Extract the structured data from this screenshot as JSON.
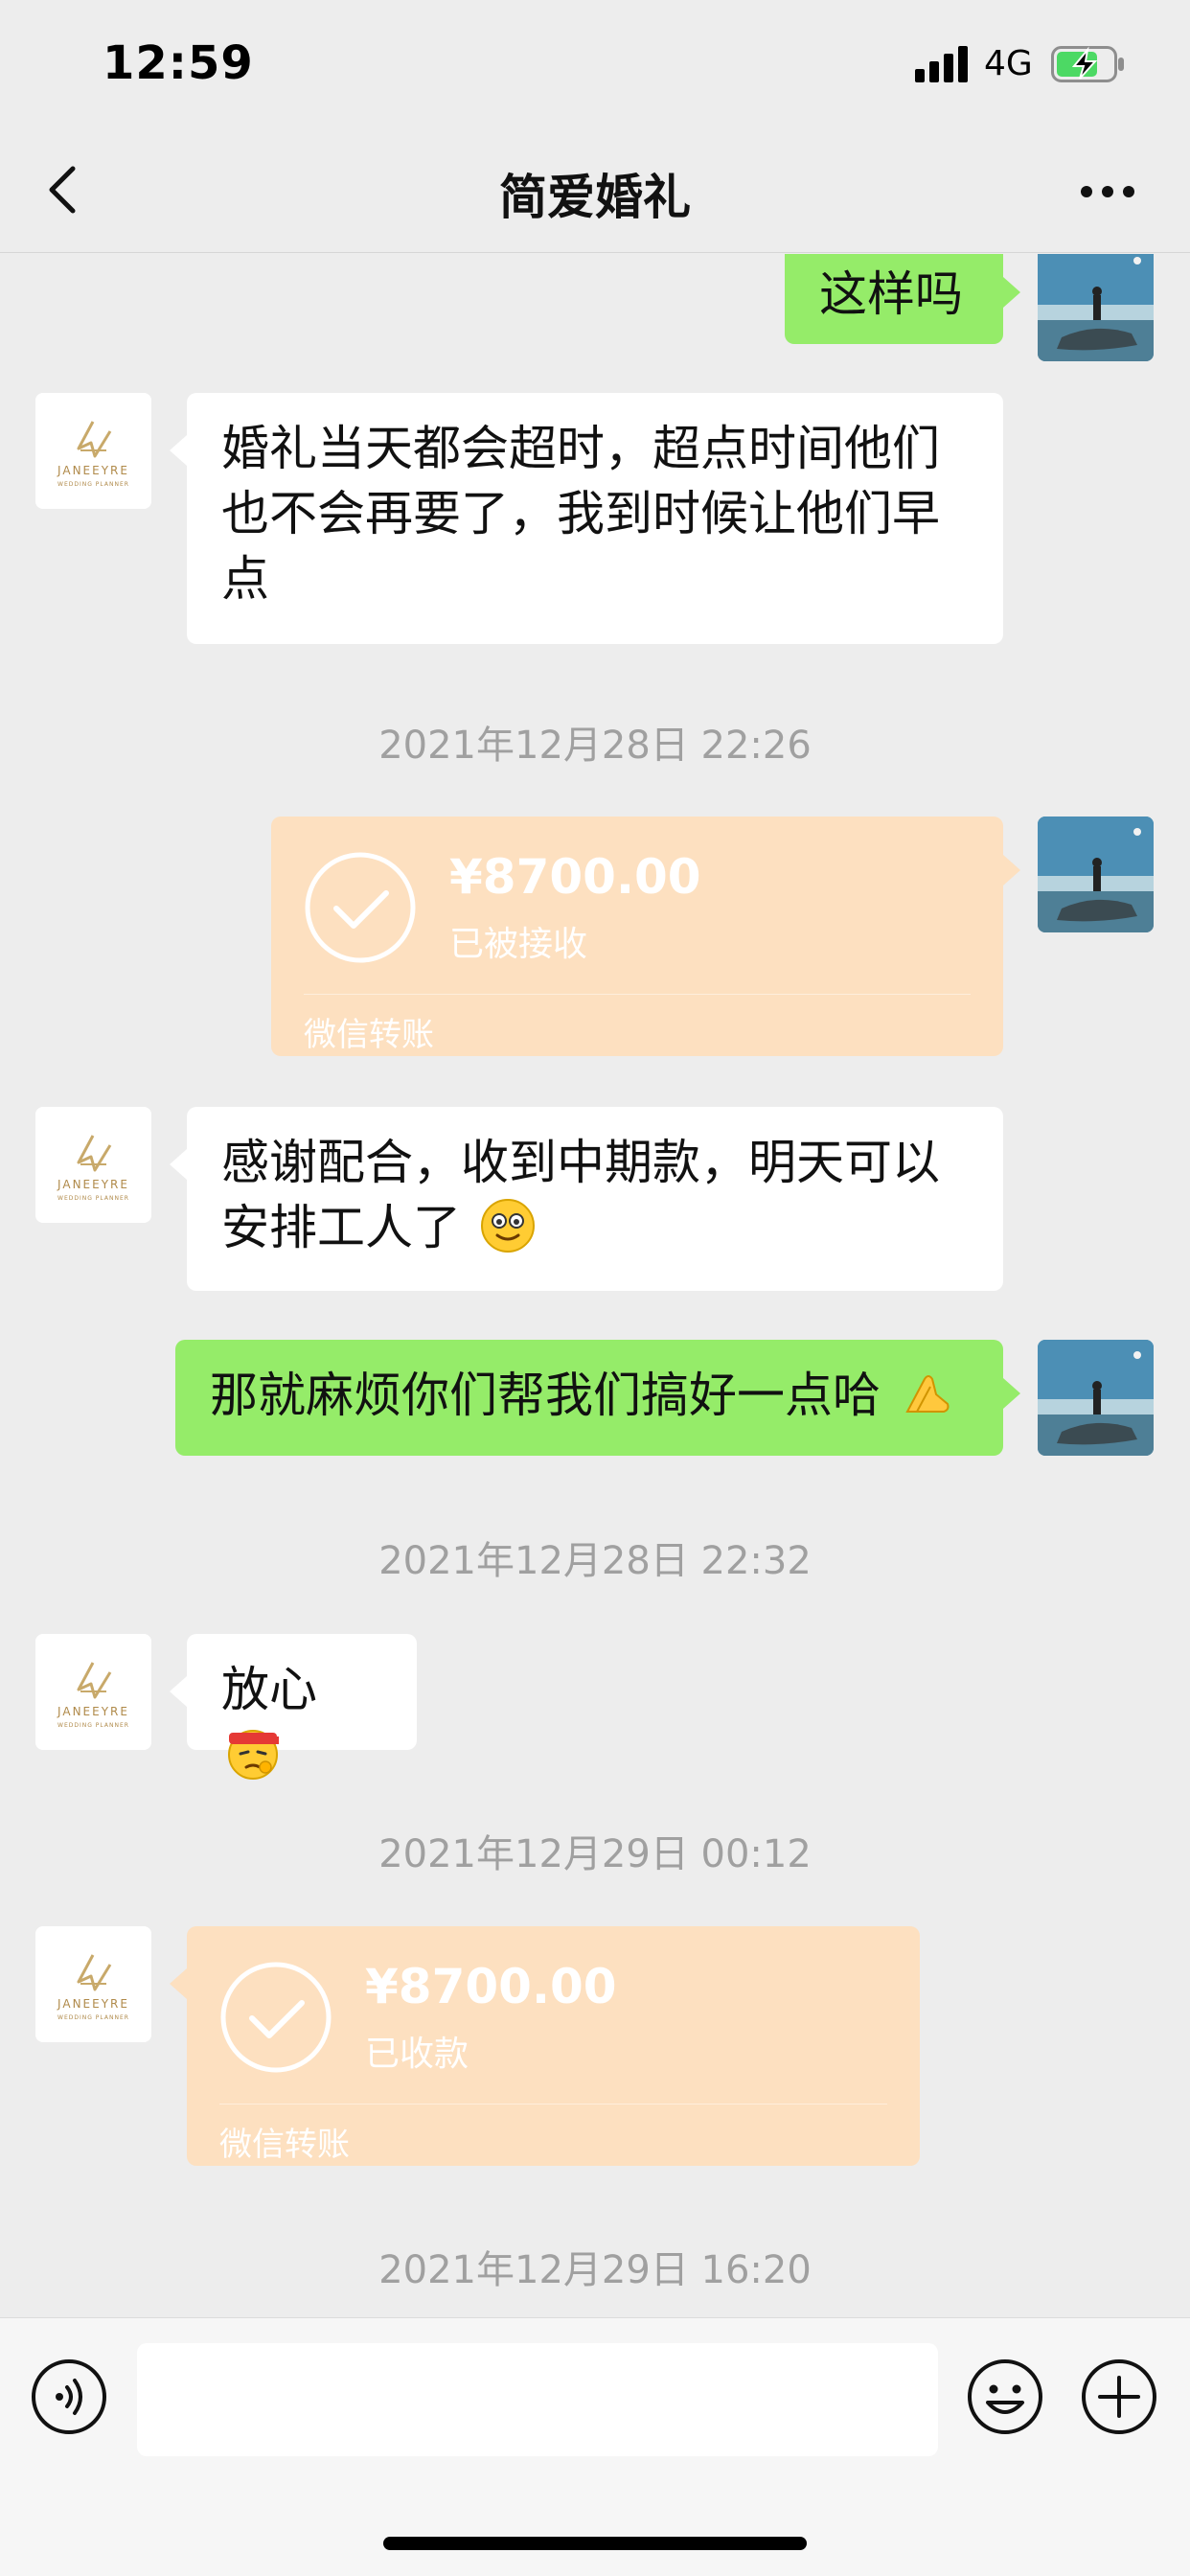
{
  "status_bar": {
    "time": "12:59",
    "network": "4G",
    "icons": [
      "signal-icon",
      "battery-charging-icon"
    ]
  },
  "nav": {
    "title": "简爱婚礼",
    "back_icon": "chevron-left-icon",
    "more_icon": "ellipsis-icon"
  },
  "contact_logo": {
    "brand": "JANEEYRE",
    "tagline": "WEDDING PLANNER"
  },
  "messages": [
    {
      "type": "text",
      "direction": "out",
      "text": "这样吗"
    },
    {
      "type": "text",
      "direction": "in",
      "lines": [
        "婚礼当天都会超时，超点时间他们",
        "也不会再要了，我到时候让他们早",
        "点"
      ]
    },
    {
      "type": "timestamp",
      "text": "2021年12月28日 22:26"
    },
    {
      "type": "transfer",
      "direction": "out",
      "amount": "¥8700.00",
      "status": "已被接收",
      "label": "微信转账"
    },
    {
      "type": "text",
      "direction": "in",
      "lines": [
        "感谢配合，收到中期款，明天可以",
        "安排工人了"
      ],
      "emoji": "smile-emoji"
    },
    {
      "type": "text",
      "direction": "out",
      "text": "那就麻烦你们帮我们搞好一点哈",
      "emoji": "pray-emoji"
    },
    {
      "type": "timestamp",
      "text": "2021年12月28日 22:32"
    },
    {
      "type": "text",
      "direction": "in",
      "text": "放心",
      "emoji": "determined-emoji"
    },
    {
      "type": "timestamp",
      "text": "2021年12月29日 00:12"
    },
    {
      "type": "transfer",
      "direction": "in",
      "amount": "¥8700.00",
      "status": "已收款",
      "label": "微信转账"
    },
    {
      "type": "timestamp",
      "text": "2021年12月29日 16:20"
    }
  ],
  "input_bar": {
    "value": "",
    "icons": [
      "voice-icon",
      "emoji-icon",
      "plus-icon"
    ]
  },
  "colors": {
    "background": "#ededed",
    "outgoing_bubble": "#95ec69",
    "incoming_bubble": "#ffffff",
    "transfer_card": "#fde0c0",
    "timestamp_text": "#a0a0a0",
    "logo_gold": "#c8a96a"
  }
}
